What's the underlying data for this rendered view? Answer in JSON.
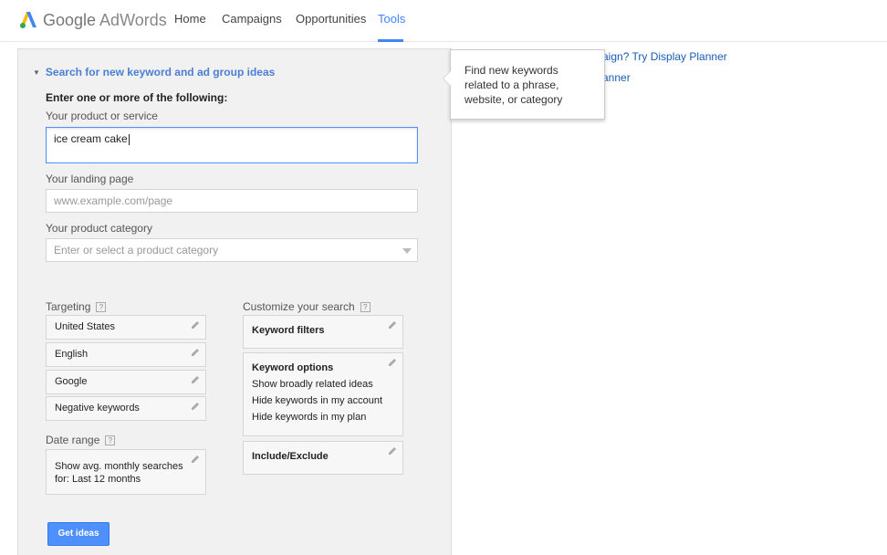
{
  "header": {
    "brand_google": "Google",
    "brand_product": "AdWords",
    "nav": [
      "Home",
      "Campaigns",
      "Opportunities",
      "Tools"
    ],
    "active_nav": "Tools",
    "accent": "#4285f4"
  },
  "panel": {
    "section_title": "Search for new keyword and ad group ideas",
    "instruction": "Enter one or more of the following:",
    "product_label": "Your product or service",
    "product_value": "ice cream cake",
    "landing_label": "Your landing page",
    "landing_placeholder": "www.example.com/page",
    "category_label": "Your product category",
    "category_placeholder": "Enter or select a product category",
    "targeting_label": "Targeting",
    "targeting_items": [
      "United States",
      "English",
      "Google",
      "Negative keywords"
    ],
    "date_label": "Date range",
    "date_line1": "Show avg. monthly searches",
    "date_line2": "for: Last 12 months",
    "customize_label": "Customize your search",
    "keyword_filters": "Keyword filters",
    "keyword_options_title": "Keyword options",
    "keyword_options": [
      "Show broadly related ideas",
      "Hide keywords in my account",
      "Hide keywords in my plan"
    ],
    "include_exclude": "Include/Exclude",
    "get_ideas": "Get ideas",
    "help_glyph": "?"
  },
  "right": {
    "link1": "aign? Try Display Planner",
    "link2": "anner"
  },
  "tooltip": {
    "text": "Find new keywords related to a phrase, website, or category"
  }
}
